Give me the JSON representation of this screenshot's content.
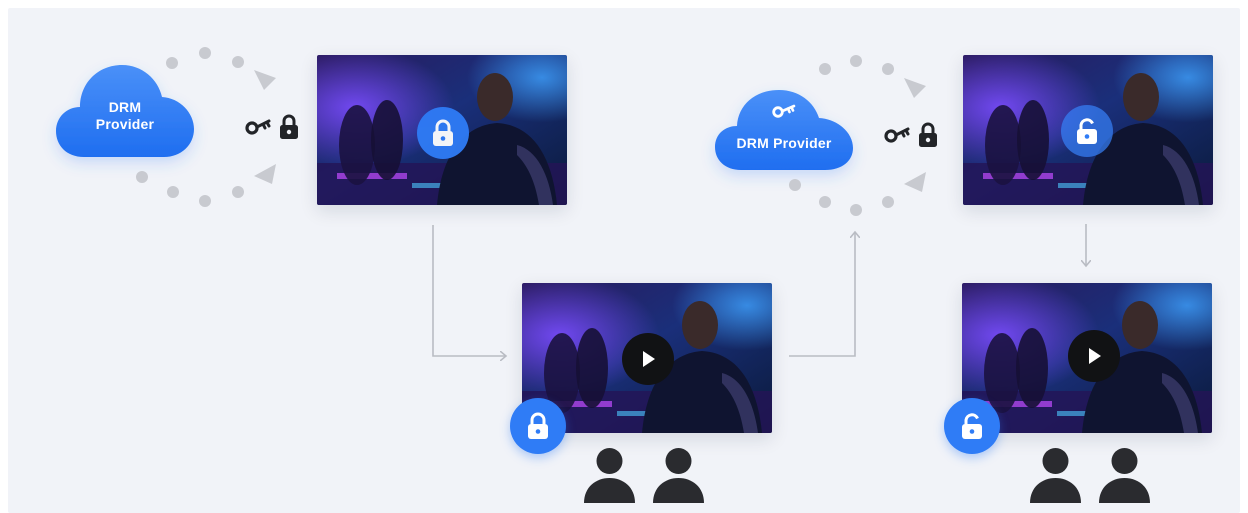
{
  "diagram": {
    "left_cloud": {
      "label": "DRM Provider",
      "icon": "cloud-icon",
      "color": "#2f7cf6"
    },
    "right_cloud": {
      "label": "DRM Provider",
      "icon": "key-icon",
      "color": "#2f7cf6"
    },
    "exchange_icons": [
      "key-icon",
      "padlock-icon"
    ],
    "videos": [
      {
        "id": "top-left",
        "overlay": "locked-padlock-icon"
      },
      {
        "id": "bottom-middle",
        "overlay": "play-icon",
        "corner": "locked-padlock-icon"
      },
      {
        "id": "top-right",
        "overlay": "unlocked-padlock-icon"
      },
      {
        "id": "bottom-right",
        "overlay": "play-icon",
        "corner": "unlocked-padlock-icon"
      }
    ],
    "viewers": [
      "user-icon",
      "user-icon"
    ],
    "colors": {
      "accent": "#2f7cf6",
      "background": "#f1f3f8",
      "dots": "#c8cad0",
      "connector": "#b9bcc3",
      "icons": "#222428"
    }
  }
}
